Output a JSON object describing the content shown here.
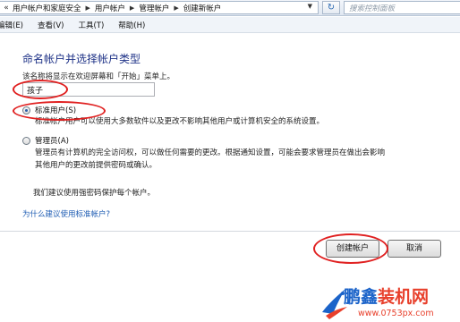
{
  "address_bar": {
    "chevron": "«",
    "breadcrumbs": [
      "用户帐户和家庭安全",
      "用户帐户",
      "管理帐户",
      "创建新帐户"
    ],
    "search_placeholder": "搜索控制面板"
  },
  "menu": {
    "items": [
      "编辑(E)",
      "查看(V)",
      "工具(T)",
      "帮助(H)"
    ]
  },
  "form": {
    "heading": "命名帐户并选择帐户类型",
    "description": "该名称将显示在欢迎屏幕和「开始」菜单上。",
    "name_value": "孩子",
    "options": [
      {
        "label": "标准用户(S)",
        "description": [
          "标准帐户用户可以使用大多数软件以及更改不影响其他用户或计算机安全的系统设置。"
        ],
        "selected": true
      },
      {
        "label": "管理员(A)",
        "description": [
          "管理员有计算机的完全访问权，可以做任何需要的更改。根据通知设置，可能会要求管理员在做出会影响",
          "其他用户的更改前提供密码或确认。"
        ],
        "selected": false
      }
    ],
    "recommendation": "我们建议使用强密码保护每个帐户。",
    "help_link": "为什么建议使用标准帐户?"
  },
  "buttons": {
    "create": "创建帐户",
    "cancel": "取消"
  },
  "watermark": {
    "brand_a": "鹏鑫",
    "brand_b": "装机网",
    "url": "www.0753px.com"
  },
  "colors": {
    "heading": "#1e3287",
    "link": "#1e5cb3",
    "annotation": "#e02020"
  }
}
